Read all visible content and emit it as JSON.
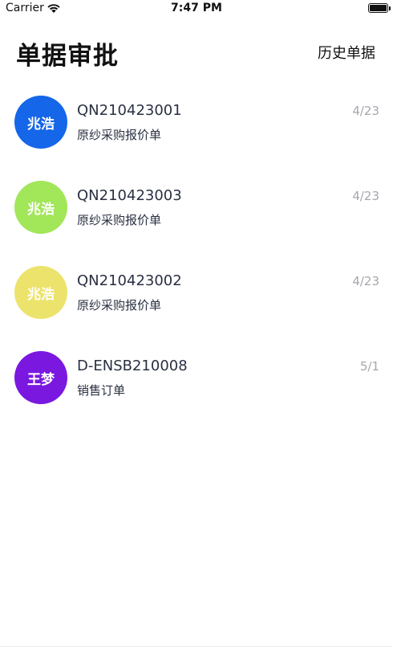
{
  "status_bar": {
    "carrier": "Carrier",
    "time": "7:47 PM",
    "icons": [
      "wifi-icon",
      "battery-icon"
    ]
  },
  "header": {
    "title": "单据审批",
    "history_label": "历史单据"
  },
  "items": [
    {
      "avatar_text": "兆浩",
      "avatar_color": "#1566e8",
      "doc_no": "QN210423001",
      "doc_type": "原纱采购报价单",
      "date": "4/23"
    },
    {
      "avatar_text": "兆浩",
      "avatar_color": "#a2e65a",
      "doc_no": "QN210423003",
      "doc_type": "原纱采购报价单",
      "date": "4/23"
    },
    {
      "avatar_text": "兆浩",
      "avatar_color": "#ece36c",
      "doc_no": "QN210423002",
      "doc_type": "原纱采购报价单",
      "date": "4/23"
    },
    {
      "avatar_text": "王梦",
      "avatar_color": "#7a18e0",
      "doc_no": "D-ENSB210008",
      "doc_type": "销售订单",
      "date": "5/1"
    }
  ]
}
